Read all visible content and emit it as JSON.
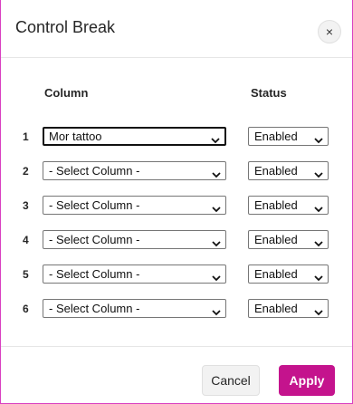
{
  "dialog": {
    "title": "Control Break",
    "close_icon": "close-icon",
    "close_glyph": "×"
  },
  "table": {
    "column_header": "Column",
    "status_header": "Status",
    "rows": [
      {
        "num": "1",
        "column": "Mor tattoo",
        "status": "Enabled"
      },
      {
        "num": "2",
        "column": "- Select Column -",
        "status": "Enabled"
      },
      {
        "num": "3",
        "column": "- Select Column -",
        "status": "Enabled"
      },
      {
        "num": "4",
        "column": "- Select Column -",
        "status": "Enabled"
      },
      {
        "num": "5",
        "column": "- Select Column -",
        "status": "Enabled"
      },
      {
        "num": "6",
        "column": "- Select Column -",
        "status": "Enabled"
      }
    ]
  },
  "footer": {
    "cancel_label": "Cancel",
    "apply_label": "Apply"
  },
  "colors": {
    "accent": "#c4138d",
    "border_accent": "#d93fc1"
  }
}
